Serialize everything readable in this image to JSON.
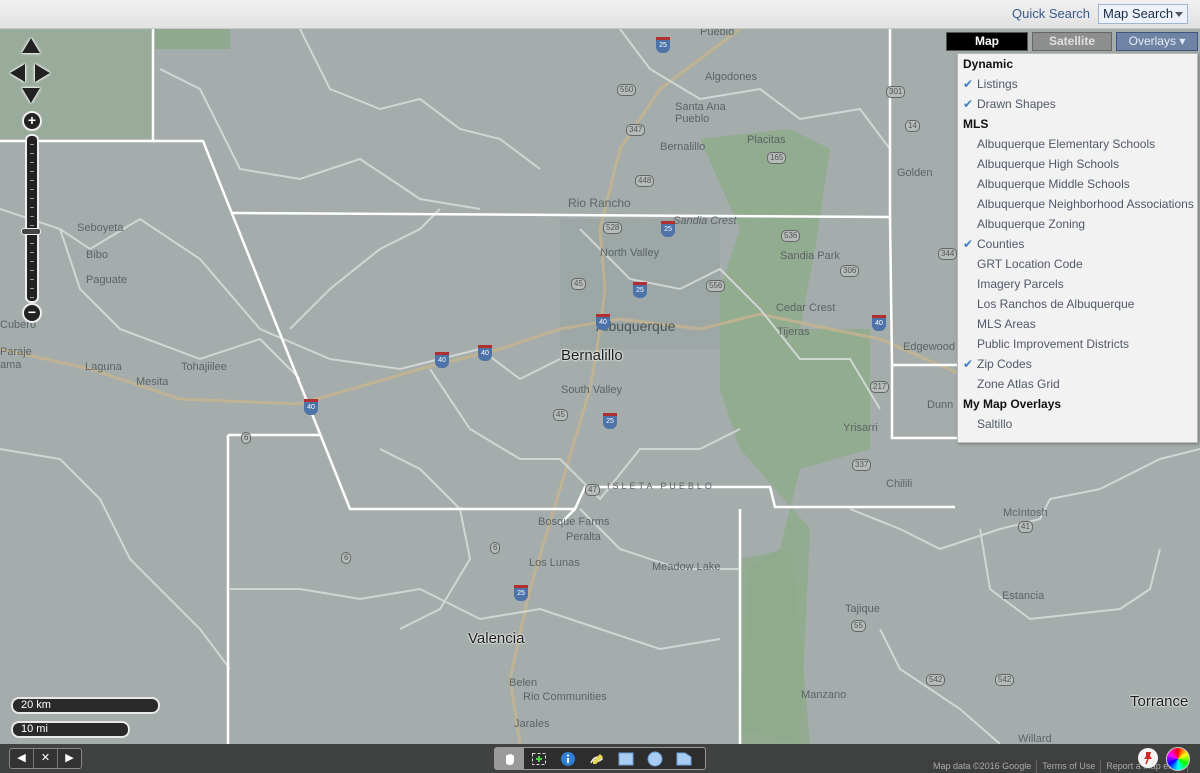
{
  "header": {
    "quick_search": "Quick Search",
    "map_search": "Map Search"
  },
  "map_type": {
    "map": "Map",
    "satellite": "Satellite",
    "overlays": "Overlays ▾",
    "selected": "Map"
  },
  "overlay_menu": {
    "sections": [
      {
        "title": "Dynamic",
        "items": [
          {
            "label": "Listings",
            "checked": true
          },
          {
            "label": "Drawn Shapes",
            "checked": true
          }
        ]
      },
      {
        "title": "MLS",
        "items": [
          {
            "label": "Albuquerque Elementary Schools",
            "checked": false
          },
          {
            "label": "Albuquerque High Schools",
            "checked": false
          },
          {
            "label": "Albuquerque Middle Schools",
            "checked": false
          },
          {
            "label": "Albuquerque Neighborhood Associations",
            "checked": false
          },
          {
            "label": "Albuquerque Zoning",
            "checked": false
          },
          {
            "label": "Counties",
            "checked": true
          },
          {
            "label": "GRT Location Code",
            "checked": false
          },
          {
            "label": "Imagery Parcels",
            "checked": false
          },
          {
            "label": "Los Ranchos de Albuquerque",
            "checked": false
          },
          {
            "label": "MLS Areas",
            "checked": false
          },
          {
            "label": "Public Improvement Districts",
            "checked": false
          },
          {
            "label": "Zip Codes",
            "checked": true
          },
          {
            "label": "Zone Atlas Grid",
            "checked": false
          }
        ]
      },
      {
        "title": "My Map Overlays",
        "items": [
          {
            "label": "Saltillo",
            "checked": false
          }
        ]
      }
    ]
  },
  "map": {
    "counties": [
      "Bernalillo",
      "Valencia",
      "Torrance"
    ],
    "places": [
      "Pueblo",
      "Algodones",
      "Santa Ana Pueblo",
      "Placitas",
      "Bernalillo",
      "Rio Rancho",
      "Sandia Crest",
      "Sandia Park",
      "North Valley",
      "Albuquerque",
      "Cedar Crest",
      "Tijeras",
      "South Valley",
      "Golden",
      "Edgewood",
      "Dunn",
      "Yrisarri",
      "Chilili",
      "Isleta Pueblo",
      "Bosque Farms",
      "Peralta",
      "Los Lunas",
      "Meadow Lake",
      "McIntosh",
      "Estancia",
      "Tajique",
      "Manzano",
      "Belen",
      "Rio Communities",
      "Jarales",
      "Willard",
      "Seboyeta",
      "Bibo",
      "Paguate",
      "Cubero",
      "Paraje",
      "Laguna",
      "Mesita",
      "Tohajiilee",
      "Cama"
    ],
    "state_routes": [
      "550",
      "347",
      "448",
      "165",
      "528",
      "45",
      "556",
      "536",
      "306",
      "14",
      "301",
      "344",
      "217",
      "337",
      "47",
      "6",
      "55",
      "41",
      "542"
    ],
    "interstates": [
      "25",
      "40"
    ]
  },
  "scale": {
    "km": "20 km",
    "mi": "10 mi"
  },
  "footer": {
    "attribution": "Map data ©2016 Google",
    "terms": "Terms of Use",
    "report": "Report a map error"
  },
  "tools": [
    "pan",
    "select-area",
    "info",
    "draw-freehand",
    "draw-rectangle",
    "draw-circle",
    "draw-polygon"
  ],
  "colors": {
    "map_active": "#000000",
    "check": "#3d7fc4",
    "link": "#3a5a8c"
  }
}
